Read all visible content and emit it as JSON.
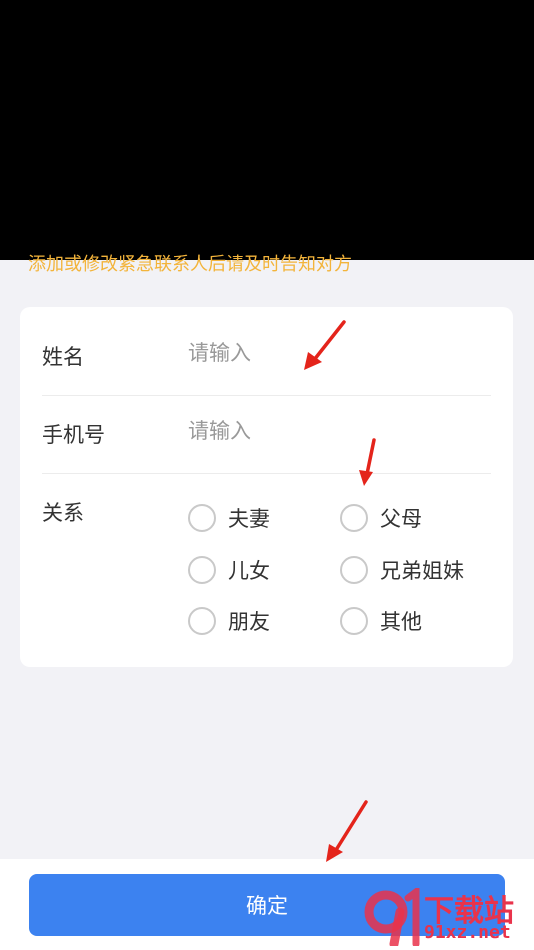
{
  "notice": "添加或修改紧急联系人后请及时告知对方",
  "form": {
    "name_label": "姓名",
    "name_placeholder": "请输入",
    "phone_label": "手机号",
    "phone_placeholder": "请输入",
    "relation_label": "关系",
    "relations": [
      "夫妻",
      "父母",
      "儿女",
      "兄弟姐妹",
      "朋友",
      "其他"
    ]
  },
  "confirm_label": "确定",
  "watermark": {
    "title": "下载站",
    "url": "91xz.net",
    "logo_text": "9"
  },
  "colors": {
    "accent": "#3c82f0",
    "notice": "#f3b43b",
    "annotation": "#e4241b"
  },
  "annotations": [
    "arrow-icon",
    "arrow-icon",
    "arrow-icon"
  ]
}
